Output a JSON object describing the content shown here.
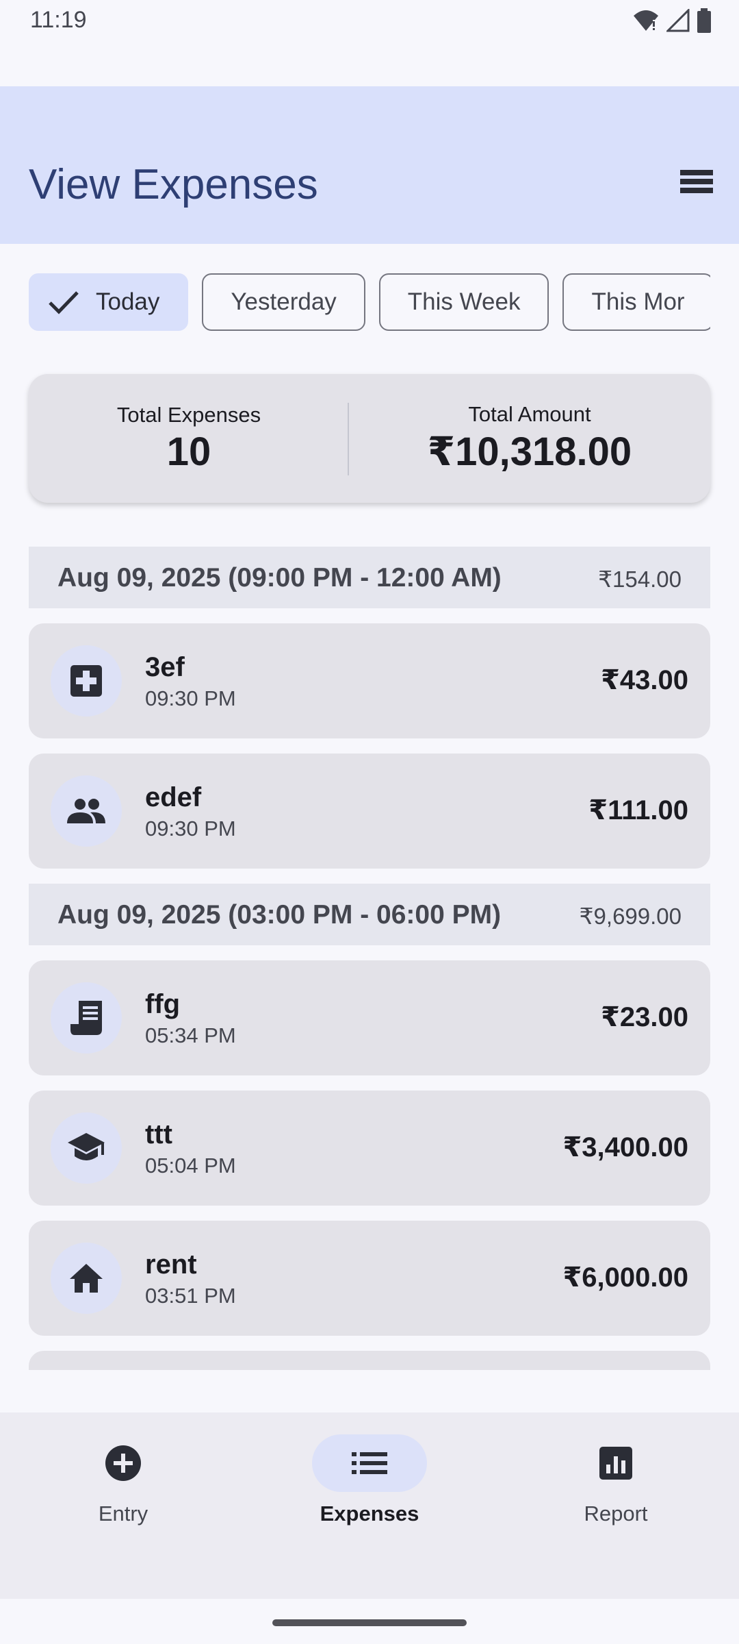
{
  "status": {
    "time": "11:19"
  },
  "header": {
    "title": "View Expenses"
  },
  "filters": [
    {
      "label": "Today",
      "selected": true
    },
    {
      "label": "Yesterday",
      "selected": false
    },
    {
      "label": "This Week",
      "selected": false
    },
    {
      "label": "This Mor",
      "selected": false
    }
  ],
  "summary": {
    "expenses_label": "Total Expenses",
    "expenses_value": "10",
    "amount_label": "Total Amount",
    "amount_value": "₹10,318.00"
  },
  "groups": [
    {
      "title": "Aug 09, 2025 (09:00 PM - 12:00 AM)",
      "total": "₹154.00",
      "items": [
        {
          "name": "3ef",
          "time": "09:30 PM",
          "amount": "₹43.00",
          "icon": "medical-icon"
        },
        {
          "name": "edef",
          "time": "09:30 PM",
          "amount": "₹111.00",
          "icon": "people-icon"
        }
      ]
    },
    {
      "title": "Aug 09, 2025 (03:00 PM - 06:00 PM)",
      "total": "₹9,699.00",
      "items": [
        {
          "name": "ffg",
          "time": "05:34 PM",
          "amount": "₹23.00",
          "icon": "receipt-icon"
        },
        {
          "name": "ttt",
          "time": "05:04 PM",
          "amount": "₹3,400.00",
          "icon": "school-icon"
        },
        {
          "name": "rent",
          "time": "03:51 PM",
          "amount": "₹6,000.00",
          "icon": "home-icon"
        }
      ]
    }
  ],
  "nav": {
    "entry": "Entry",
    "expenses": "Expenses",
    "report": "Report"
  }
}
